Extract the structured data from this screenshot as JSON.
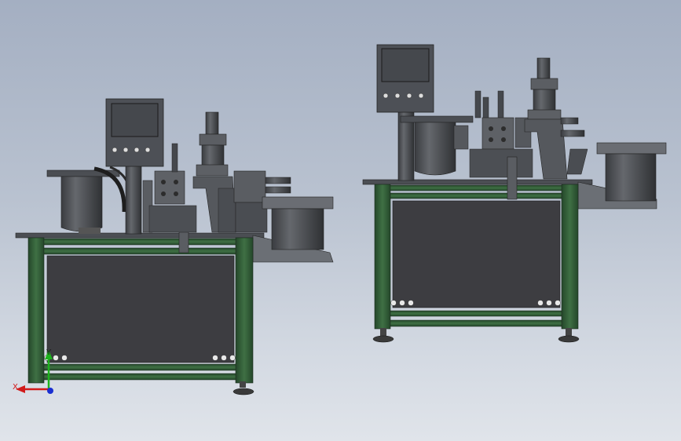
{
  "triad": {
    "x_label": "X",
    "y_label": "Y",
    "x_color": "#d11a1a",
    "y_color": "#1db31d",
    "z_color": "#1a2fd1"
  },
  "colors": {
    "frame_green": "#2f5a34",
    "frame_green_light": "#4f8453",
    "panel_dark": "#3c3c40",
    "metal": "#5a5d62",
    "metal_light": "#7c8086",
    "screen": "#4a4d52"
  }
}
